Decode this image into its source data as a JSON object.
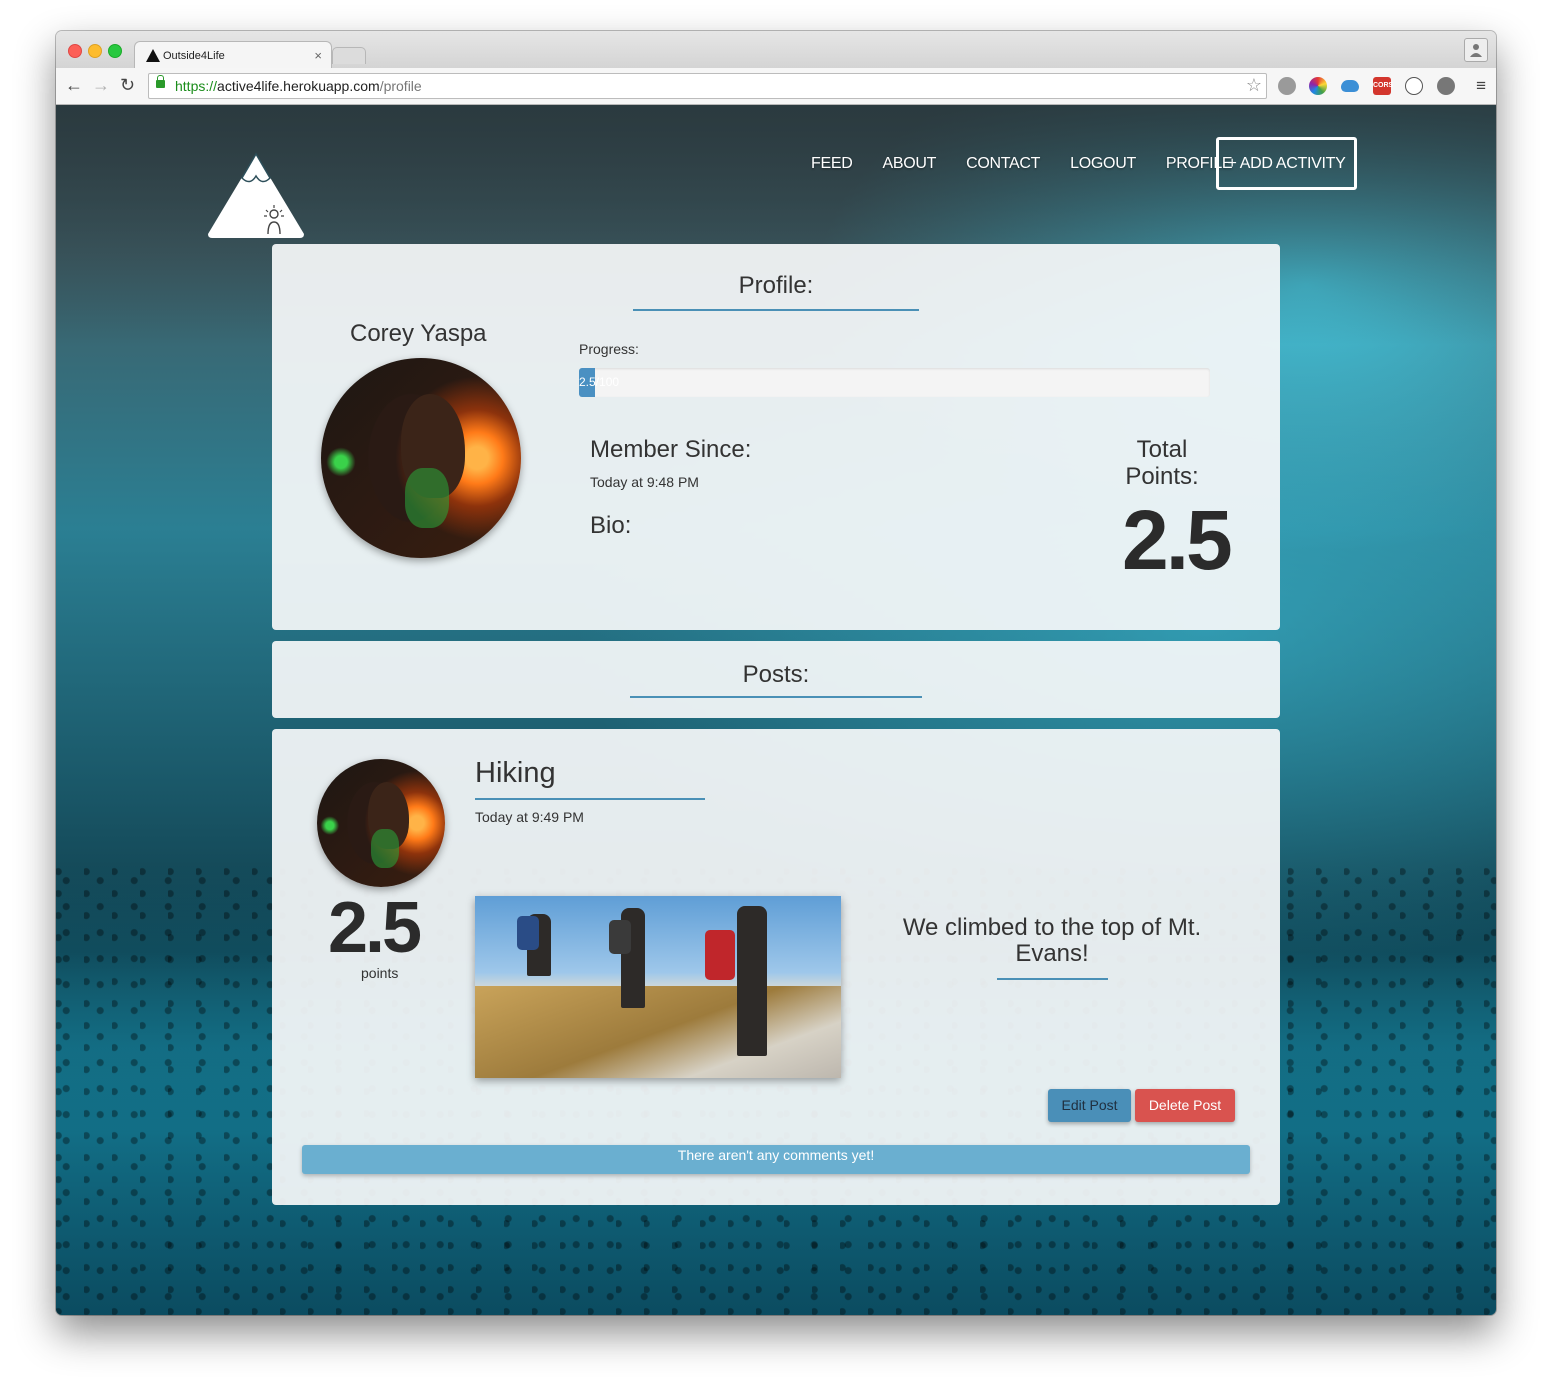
{
  "browser": {
    "tab_title": "Outside4Life",
    "tab_close": "×",
    "url_scheme": "https://",
    "url_host": "active4life.herokuapp.com",
    "url_path": "/profile",
    "back_icon": "←",
    "forward_icon": "→",
    "reload_icon": "↻",
    "star_icon": "☆",
    "menu_icon": "≡",
    "extension_cors_label": "CORS"
  },
  "nav": {
    "items": [
      "FEED",
      "ABOUT",
      "CONTACT",
      "LOGOUT",
      "PROFILE"
    ],
    "add_activity": "+ ADD ACTIVITY"
  },
  "profile": {
    "heading": "Profile:",
    "name": "Corey Yaspa",
    "progress_label": "Progress:",
    "progress_text": "2.5/100",
    "progress_fraction": 0.025,
    "member_since_label": "Member Since:",
    "member_since_value": "Today at 9:48 PM",
    "bio_label": "Bio:",
    "total_points_label": "Total Points:",
    "total_points_value": "2.5"
  },
  "posts": {
    "heading": "Posts:",
    "items": [
      {
        "title": "Hiking",
        "date": "Today at 9:49 PM",
        "points": "2.5",
        "points_label": "points",
        "caption": "We climbed to the top of Mt. Evans!",
        "edit_label": "Edit Post",
        "delete_label": "Delete Post",
        "comments_empty": "There aren't any comments yet!"
      }
    ]
  },
  "colors": {
    "accent": "#4a90b6",
    "danger": "#d9534f",
    "info": "#6aafd0"
  }
}
